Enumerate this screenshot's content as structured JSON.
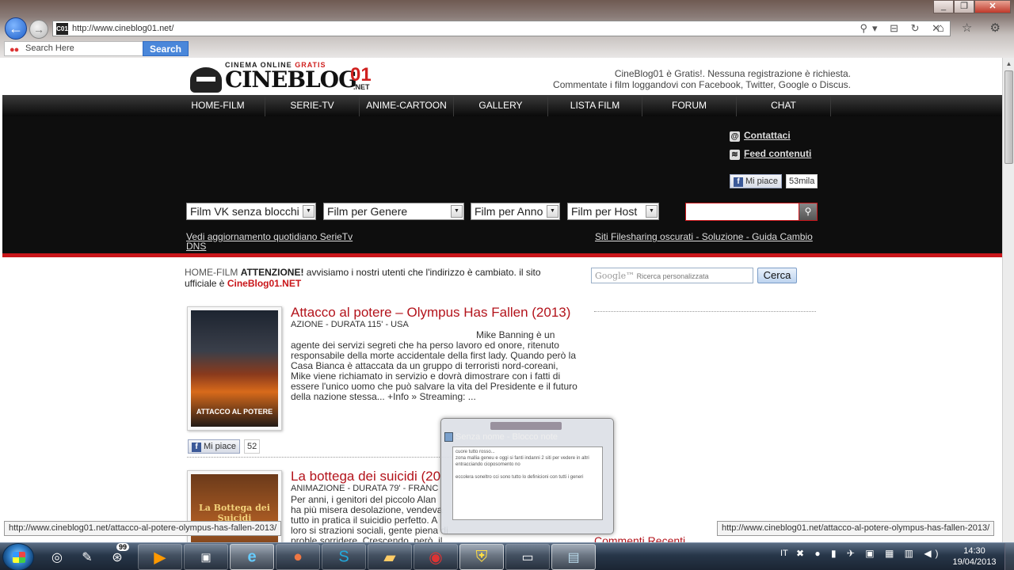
{
  "browser": {
    "url": "http://www.cineblog01.net/",
    "favicon": "C01",
    "search_placeholder": "Search Here",
    "search_button": "Search",
    "window_buttons": [
      "_",
      "❐",
      "✕"
    ],
    "address_icons": "⚲▾ ⊟ ↻ ✕",
    "toolbar_icons": "⌂ ☆ ⚙"
  },
  "site": {
    "logo_top_a": "CINEMA  ONLINE",
    "logo_top_b": "GRATIS",
    "logo_main": "CINEBLOG",
    "logo_num": "01",
    "logo_net": ".NET",
    "header_line1": "CineBlog01 è Gratis!. Nessuna registrazione è richiesta.",
    "header_line2": "Commentate i film loggandovi con Facebook, Twitter, Google o Discus.",
    "nav": [
      "HOME-FILM",
      "SERIE-TV",
      "ANIME-CARTOON",
      "GALLERY",
      "LISTA FILM",
      "FORUM",
      "CHAT"
    ],
    "contattaci": "Contattaci",
    "feed": "Feed contenuti",
    "like_label": "Mi piace",
    "like_count": "53mila",
    "dropdowns": [
      "Film VK senza blocchi",
      "Film per Genere",
      "Film per Anno",
      "Film per Host"
    ],
    "link_serie_1": "Vedi aggiornamento quotidiano SerieTv",
    "link_serie_2": "DNS",
    "link_filesharing": "Siti Filesharing oscurati - Soluzione - Guida Cambio",
    "notice_home": "HOME-FILM",
    "notice_bold": "ATTENZIONE!",
    "notice_text": " avvisiamo i nostri utenti che l'indirizzo è cambiato. il sito ufficiale è ",
    "notice_site": "CineBlog01.NET",
    "google_label": "Google™",
    "google_placeholder": "Ricerca personalizzata",
    "cerca": "Cerca",
    "commenti": "Commenti Recenti"
  },
  "movies": [
    {
      "title": "Attacco al potere – Olympus Has Fallen (2013)",
      "meta": "AZIONE - DURATA 115' - USA",
      "lead": "Mike Banning è un",
      "desc": "agente dei servizi segreti che ha perso lavoro ed onore, ritenuto responsabile della morte accidentale della first lady. Quando però la Casa Bianca è attaccata da un gruppo di terroristi nord-coreani, Mike viene richiamato in servizio e dovrà dimostrare con i fatti di essere l'unico uomo che può salvare la vita del Presidente e il futuro della nazione stessa... +Info »   Streaming: ...",
      "poster_title": "ATTACCO AL POTERE",
      "like_label": "Mi piace",
      "like_count": "52"
    },
    {
      "title": "La bottega dei suicidi (20",
      "meta": "ANIMAZIONE - DURATA 79' - FRANC",
      "desc": "Per anni, i genitori del piccolo Alan ha più misera desolazione, vendeva tutto in pratica il suicidio perfetto. A loro si strazioni sociali, gente piena di proble sorridere. Crescendo, però, il piccolo Alan è diventato un bambino",
      "poster_title": "La Bottega dei Suicidi"
    }
  ],
  "notepad": {
    "title": "Senza nome - Blocco note",
    "lines": [
      "cuore tutto rosso...",
      "zona mallia geneu e oggi si fanti indanni 2 siti per vedere in altri",
      "entracciando cioposomento no",
      "",
      "eccolera soneltro cci sono tutto lo definicioni con tutti i generi"
    ]
  },
  "status_tip": "http://www.cineblog01.net/attacco-al-potere-olympus-has-fallen-2013/",
  "taskbar": {
    "badge": "99",
    "language": "IT",
    "time": "14:30",
    "date": "19/04/2013"
  }
}
